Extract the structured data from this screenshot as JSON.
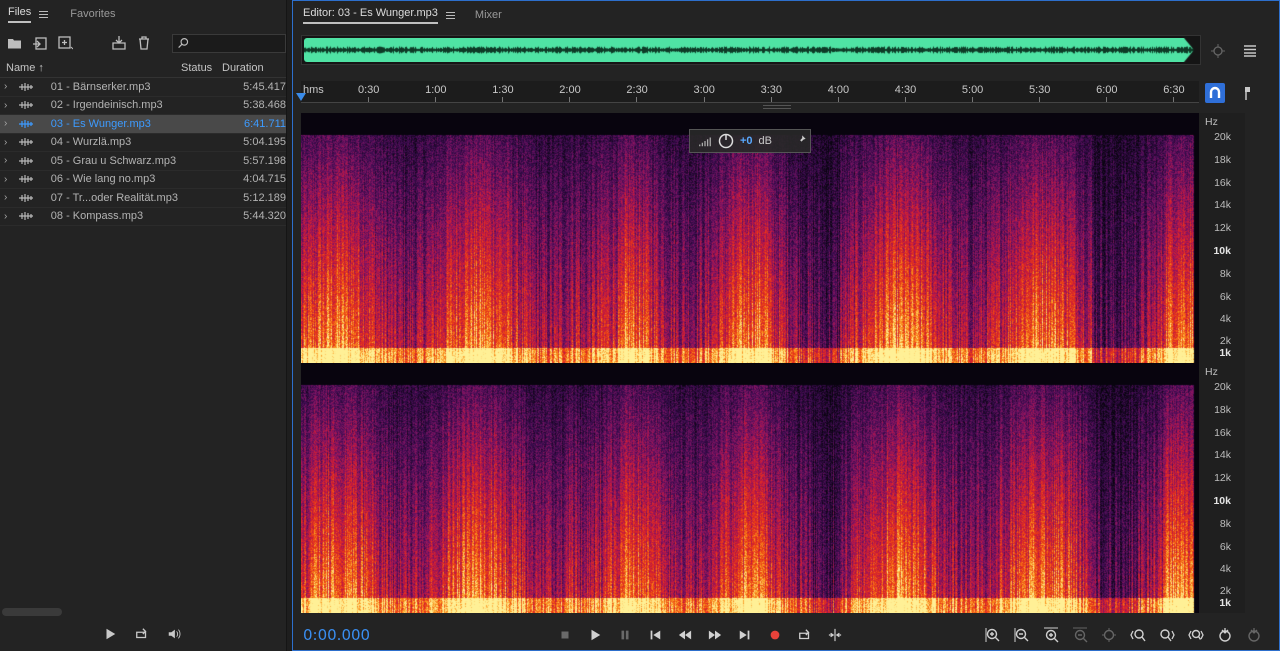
{
  "files_panel": {
    "tabs": [
      {
        "label": "Files",
        "active": true
      },
      {
        "label": "Favorites",
        "active": false
      }
    ],
    "search": {
      "value": "",
      "placeholder": ""
    },
    "columns": {
      "name": "Name",
      "sort_arrow": "↑",
      "status": "Status",
      "duration": "Duration"
    },
    "files": [
      {
        "name": "01 - Bärnserker.mp3",
        "status": "",
        "duration": "5:45.417",
        "selected": false
      },
      {
        "name": "02 - Irgendeinisch.mp3",
        "status": "",
        "duration": "5:38.468",
        "selected": false
      },
      {
        "name": "03 - Es Wunger.mp3",
        "status": "",
        "duration": "6:41.711",
        "selected": true
      },
      {
        "name": "04 - Wurzlä.mp3",
        "status": "",
        "duration": "5:04.195",
        "selected": false
      },
      {
        "name": "05 - Grau u Schwarz.mp3",
        "status": "",
        "duration": "5:57.198",
        "selected": false
      },
      {
        "name": "06 - Wie lang no.mp3",
        "status": "",
        "duration": "4:04.715",
        "selected": false
      },
      {
        "name": "07 - Tr...oder Realität.mp3",
        "status": "",
        "duration": "5:12.189",
        "selected": false
      },
      {
        "name": "08 - Kompass.mp3",
        "status": "",
        "duration": "5:44.320",
        "selected": false
      }
    ]
  },
  "editor": {
    "tabs": [
      {
        "label": "Editor: 03 - Es Wunger.mp3",
        "active": true
      },
      {
        "label": "Mixer",
        "active": false
      }
    ],
    "timeline": {
      "unit": "hms",
      "labels": [
        "0:30",
        "1:00",
        "1:30",
        "2:00",
        "2:30",
        "3:00",
        "3:30",
        "4:00",
        "4:30",
        "5:00",
        "5:30",
        "6:00",
        "6:30"
      ]
    },
    "hud": {
      "gain": "+0",
      "unit": "dB"
    },
    "hz_axis": {
      "title": "Hz",
      "labels": [
        "20k",
        "18k",
        "16k",
        "14k",
        "12k",
        "10k",
        "8k",
        "6k",
        "4k",
        "2k",
        "1k"
      ],
      "bold": [
        "10k",
        "1k"
      ]
    },
    "current_time": "0:00.000",
    "colors": {
      "accent": "#3a8ef0",
      "waveform": "#4fe3a4",
      "record": "#e8423a",
      "selected_file": "#3d9bff"
    }
  }
}
